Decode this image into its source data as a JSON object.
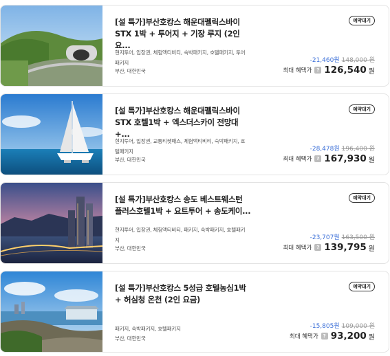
{
  "products": [
    {
      "title": "[설 특가]부산호캉스 해운대펠릭스바이 STX 1박 + 투어지 + 기장 루지 (2인 요...",
      "tags": "현지투어, 입장권, 체험액티비티, 숙박패키지, 호텔패키지, 투어패키지",
      "location": "부산, 대한민국",
      "badge": "예약대기",
      "discount": "-21,460원",
      "original_price": "148,000 원",
      "price_label": "최대 혜택가",
      "price": "126,540",
      "currency": "원",
      "image_icon": "coastal-tunnel-image"
    },
    {
      "title": "[설 특가]부산호캉스 해운대펠릭스바이 STX 호텔1박 + 엑스더스카이 전망대 +...",
      "tags": "현지투어, 입장권, 교통티켓패스, 체험액티비티, 숙박패키지, 호텔패키지",
      "location": "부산, 대한민국",
      "badge": "예약대기",
      "discount": "-28,478원",
      "original_price": "196,400 원",
      "price_label": "최대 혜택가",
      "price": "167,930",
      "currency": "원",
      "image_icon": "catamaran-image"
    },
    {
      "title": "[설 특가]부산호캉스 송도 베스트웨스턴 플러스호텔1박 + 요트투어 + 송도케이...",
      "tags": "현지투어, 입장권, 체험액티비티, 패키지, 숙박패키지, 호텔패키지",
      "location": "부산, 대한민국",
      "badge": "예약대기",
      "discount": "-23,707원",
      "original_price": "163,500 원",
      "price_label": "최대 혜택가",
      "price": "139,795",
      "currency": "원",
      "image_icon": "night-city-image"
    },
    {
      "title": "[설 특가]부산호캉스 5성급 호텔농심1박 + 허심청 온천 (2인 요금)",
      "tags": "패키지, 숙박패키지, 호텔패키지",
      "location": "부산, 대한민국",
      "badge": "예약대기",
      "discount": "-15,805원",
      "original_price": "109,000 원",
      "price_label": "최대 혜택가",
      "price": "93,200",
      "currency": "원",
      "image_icon": "coast-pavilion-image"
    }
  ],
  "colors": {
    "discount": "#3b6fd8",
    "border": "#e3e3e3",
    "strike": "#999999"
  }
}
